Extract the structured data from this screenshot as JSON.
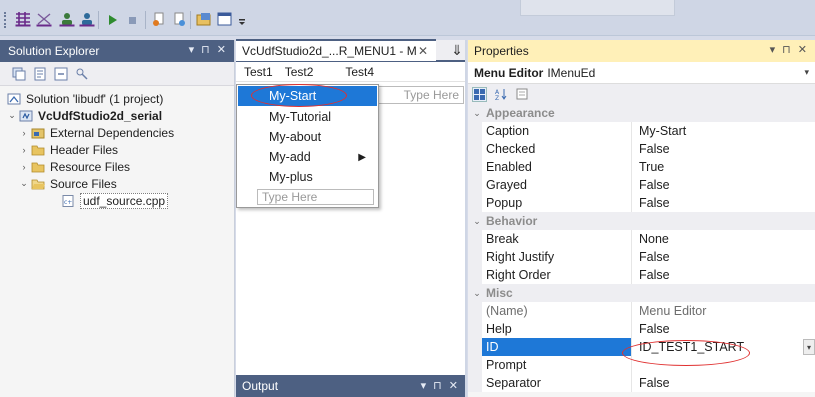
{
  "toolbar": {
    "icons": [
      "grid-icon",
      "close-doc-icon",
      "users-icon",
      "users-up-icon",
      "run-icon",
      "stop-icon",
      "page-icon",
      "page-star-icon",
      "folder-image-icon",
      "window-icon",
      "overflow-icon"
    ]
  },
  "solution_explorer": {
    "title": "Solution Explorer",
    "controls": "▾ ⊓ ✕",
    "tree": [
      {
        "label": "Solution 'libudf' (1 project)",
        "level": 0,
        "arrow": "",
        "icon": "solution-icon",
        "bold": false
      },
      {
        "label": "VcUdfStudio2d_serial",
        "level": 0,
        "arrow": "⌄",
        "icon": "project-icon",
        "bold": true
      },
      {
        "label": "External Dependencies",
        "level": 1,
        "arrow": "›",
        "icon": "dependencies-icon",
        "bold": false
      },
      {
        "label": "Header Files",
        "level": 1,
        "arrow": "›",
        "icon": "folder-icon",
        "bold": false
      },
      {
        "label": "Resource Files",
        "level": 1,
        "arrow": "›",
        "icon": "folder-icon",
        "bold": false
      },
      {
        "label": "Source Files",
        "level": 1,
        "arrow": "⌄",
        "icon": "folder-open-icon",
        "bold": false
      },
      {
        "label": "udf_source.cpp",
        "level": 2,
        "arrow": "",
        "icon": "cpp-file-icon",
        "bold": false,
        "selected": true
      }
    ]
  },
  "editor": {
    "tab_label": "VcUdfStudio2d_...R_MENU1 - M",
    "tab_close": "✕",
    "tab_dropdown": "⇓",
    "menubar": [
      "Test1",
      "Test2",
      "Test4"
    ],
    "side_type_here": "Type Here",
    "dropdown_items": [
      {
        "label": "My-Start",
        "selected": true,
        "submenu": false
      },
      {
        "label": "My-Tutorial",
        "selected": false,
        "submenu": false
      },
      {
        "label": "My-about",
        "selected": false,
        "submenu": false
      },
      {
        "label": "My-add",
        "selected": false,
        "submenu": true
      },
      {
        "label": "My-plus",
        "selected": false,
        "submenu": false
      }
    ],
    "dropdown_type_here": "Type Here"
  },
  "output": {
    "title": "Output",
    "controls": "▾ ⊓ ✕"
  },
  "properties": {
    "title": "Properties",
    "controls": "▾ ⊓ ✕",
    "object_name": "Menu Editor",
    "object_type": "IMenuEd",
    "categories": [
      {
        "name": "Appearance",
        "rows": [
          {
            "name": "Caption",
            "value": "My-Start"
          },
          {
            "name": "Checked",
            "value": "False"
          },
          {
            "name": "Enabled",
            "value": "True"
          },
          {
            "name": "Grayed",
            "value": "False"
          },
          {
            "name": "Popup",
            "value": "False"
          }
        ]
      },
      {
        "name": "Behavior",
        "rows": [
          {
            "name": "Break",
            "value": "None"
          },
          {
            "name": "Right Justify",
            "value": "False"
          },
          {
            "name": "Right Order",
            "value": "False"
          }
        ]
      },
      {
        "name": "Misc",
        "rows": [
          {
            "name": "(Name)",
            "value": "Menu Editor",
            "grey": true
          },
          {
            "name": "Help",
            "value": "False"
          },
          {
            "name": "ID",
            "value": "ID_TEST1_START",
            "selected": true
          },
          {
            "name": "Prompt",
            "value": ""
          },
          {
            "name": "Separator",
            "value": "False"
          }
        ]
      }
    ]
  },
  "colors": {
    "titlebar": "#4d6082",
    "selection": "#1e78d7",
    "properties_title": "#fff0b8",
    "annotation": "#e03030"
  }
}
